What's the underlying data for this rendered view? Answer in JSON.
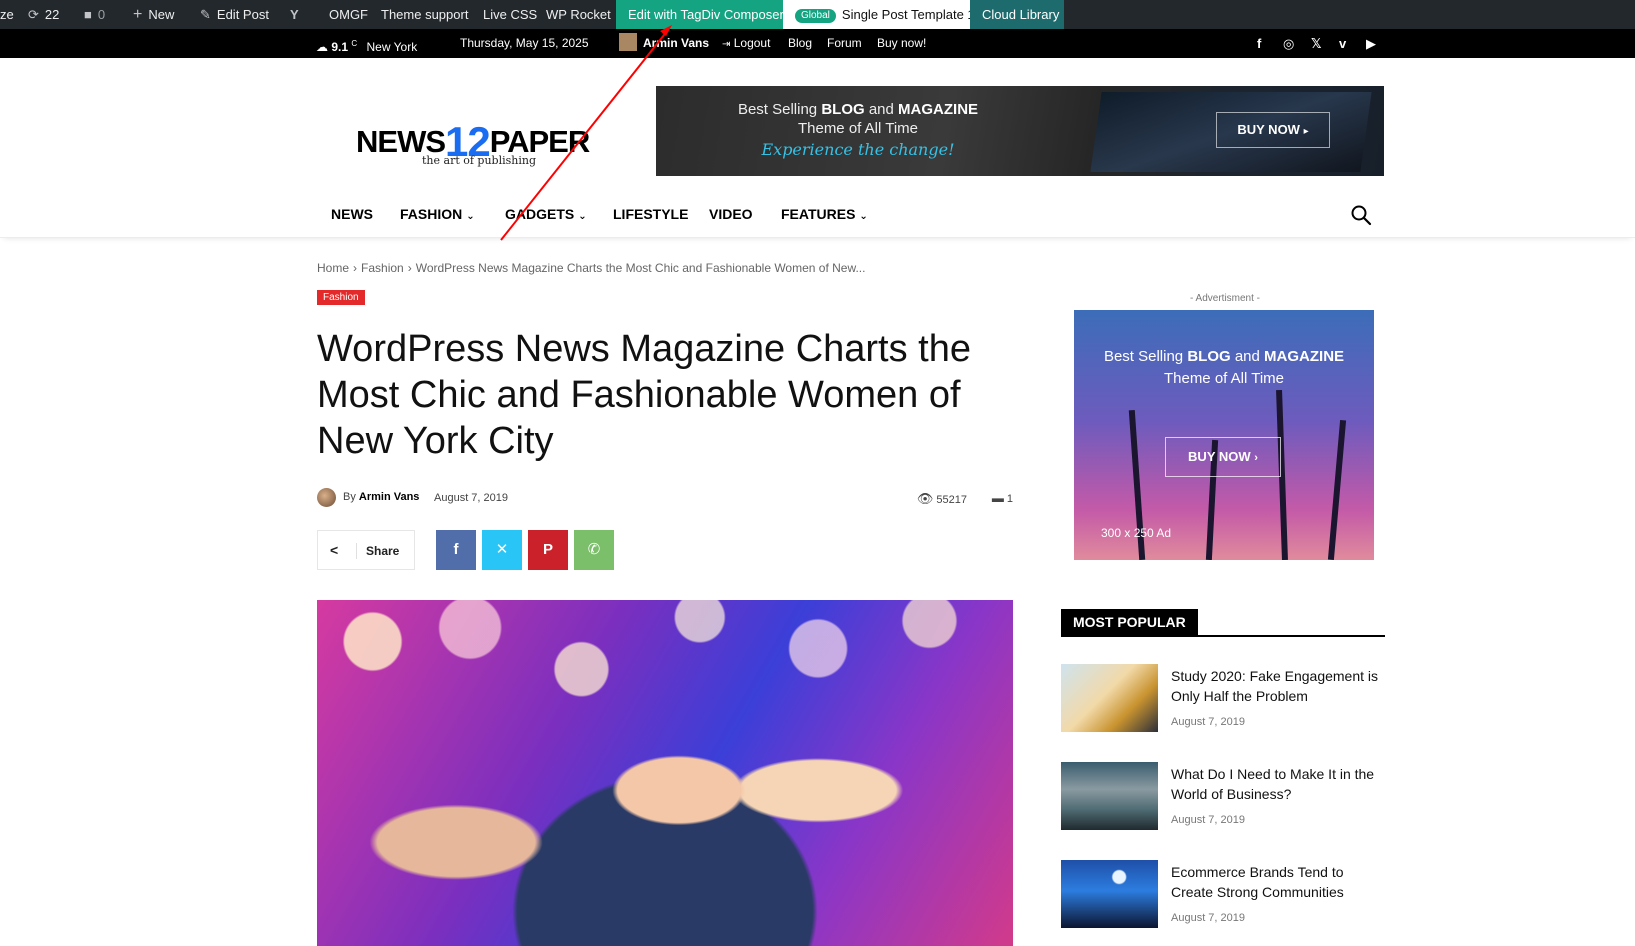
{
  "admin_bar": {
    "customize_partial": "ze",
    "updates_count": "22",
    "comments_count": "0",
    "new_label": "New",
    "edit_post_label": "Edit Post",
    "omgf_label": "OMGF",
    "theme_support_label": "Theme support",
    "live_css_label": "Live CSS",
    "wp_rocket_label": "WP Rocket",
    "tagdiv_label": "Edit with TagDiv Composer",
    "template_badge": "Global",
    "template_label": "Single Post Template 1",
    "cloud_library_label": "Cloud Library"
  },
  "top_bar": {
    "weather_temp": "9.1",
    "weather_unit": "C",
    "city": "New York",
    "date": "Thursday, May 15, 2025",
    "user_name": "Armin Vans",
    "logout_label": "Logout",
    "menu": [
      "Blog",
      "Forum",
      "Buy now!"
    ],
    "social_icons": [
      "facebook-icon",
      "instagram-icon",
      "x-icon",
      "vimeo-icon",
      "youtube-icon"
    ]
  },
  "header": {
    "logo_part1": "NEWS",
    "logo_part2": "12",
    "logo_part3": "PAPER",
    "logo_tagline": "the art of publishing",
    "banner_line1_a": "Best Selling",
    "banner_line1_b": "BLOG",
    "banner_line1_c": "and",
    "banner_line1_d": "MAGAZINE",
    "banner_line2": "Theme of All Time",
    "banner_line3": "Experience the change!",
    "banner_button": "BUY NOW"
  },
  "nav": {
    "items": [
      {
        "label": "NEWS",
        "has_dropdown": false
      },
      {
        "label": "FASHION",
        "has_dropdown": true
      },
      {
        "label": "GADGETS",
        "has_dropdown": true
      },
      {
        "label": "LIFESTYLE",
        "has_dropdown": false
      },
      {
        "label": "VIDEO",
        "has_dropdown": false
      },
      {
        "label": "FEATURES",
        "has_dropdown": true
      }
    ]
  },
  "breadcrumb": {
    "home": "Home",
    "category": "Fashion",
    "current": "WordPress News Magazine Charts the Most Chic and Fashionable Women of New..."
  },
  "post": {
    "category": "Fashion",
    "title": "WordPress News Magazine Charts the Most Chic and Fashionable Women of New York City",
    "by_label": "By",
    "author": "Armin Vans",
    "date": "August 7, 2019",
    "views": "55217",
    "comments": "1",
    "share_label": "Share"
  },
  "sidebar": {
    "ad_label": "- Advertisment -",
    "ad_line1_a": "Best Selling",
    "ad_line1_b": "BLOG",
    "ad_line1_c": "and",
    "ad_line1_d": "MAGAZINE",
    "ad_line2": "Theme of All Time",
    "ad_button": "BUY NOW",
    "ad_size": "300 x 250 Ad",
    "most_popular_title": "MOST POPULAR",
    "most_popular": [
      {
        "title": "Study 2020: Fake Engagement is Only Half the Problem",
        "date": "August 7, 2019"
      },
      {
        "title": "What Do I Need to Make It in the World of Business?",
        "date": "August 7, 2019"
      },
      {
        "title": "Ecommerce Brands Tend to Create Strong Communities",
        "date": "August 7, 2019"
      }
    ]
  },
  "colors": {
    "admin_bar_bg": "#23282d",
    "tagdiv_green": "#14a481",
    "cloud_library_bg": "#1e6b6e",
    "category_red": "#e32929",
    "logo_blue": "#1a6df1",
    "facebook": "#516eab",
    "x": "#29c5f6",
    "pinterest": "#ca212a",
    "whatsapp": "#7bbf6a",
    "annotation_arrow": "#ff0000"
  }
}
